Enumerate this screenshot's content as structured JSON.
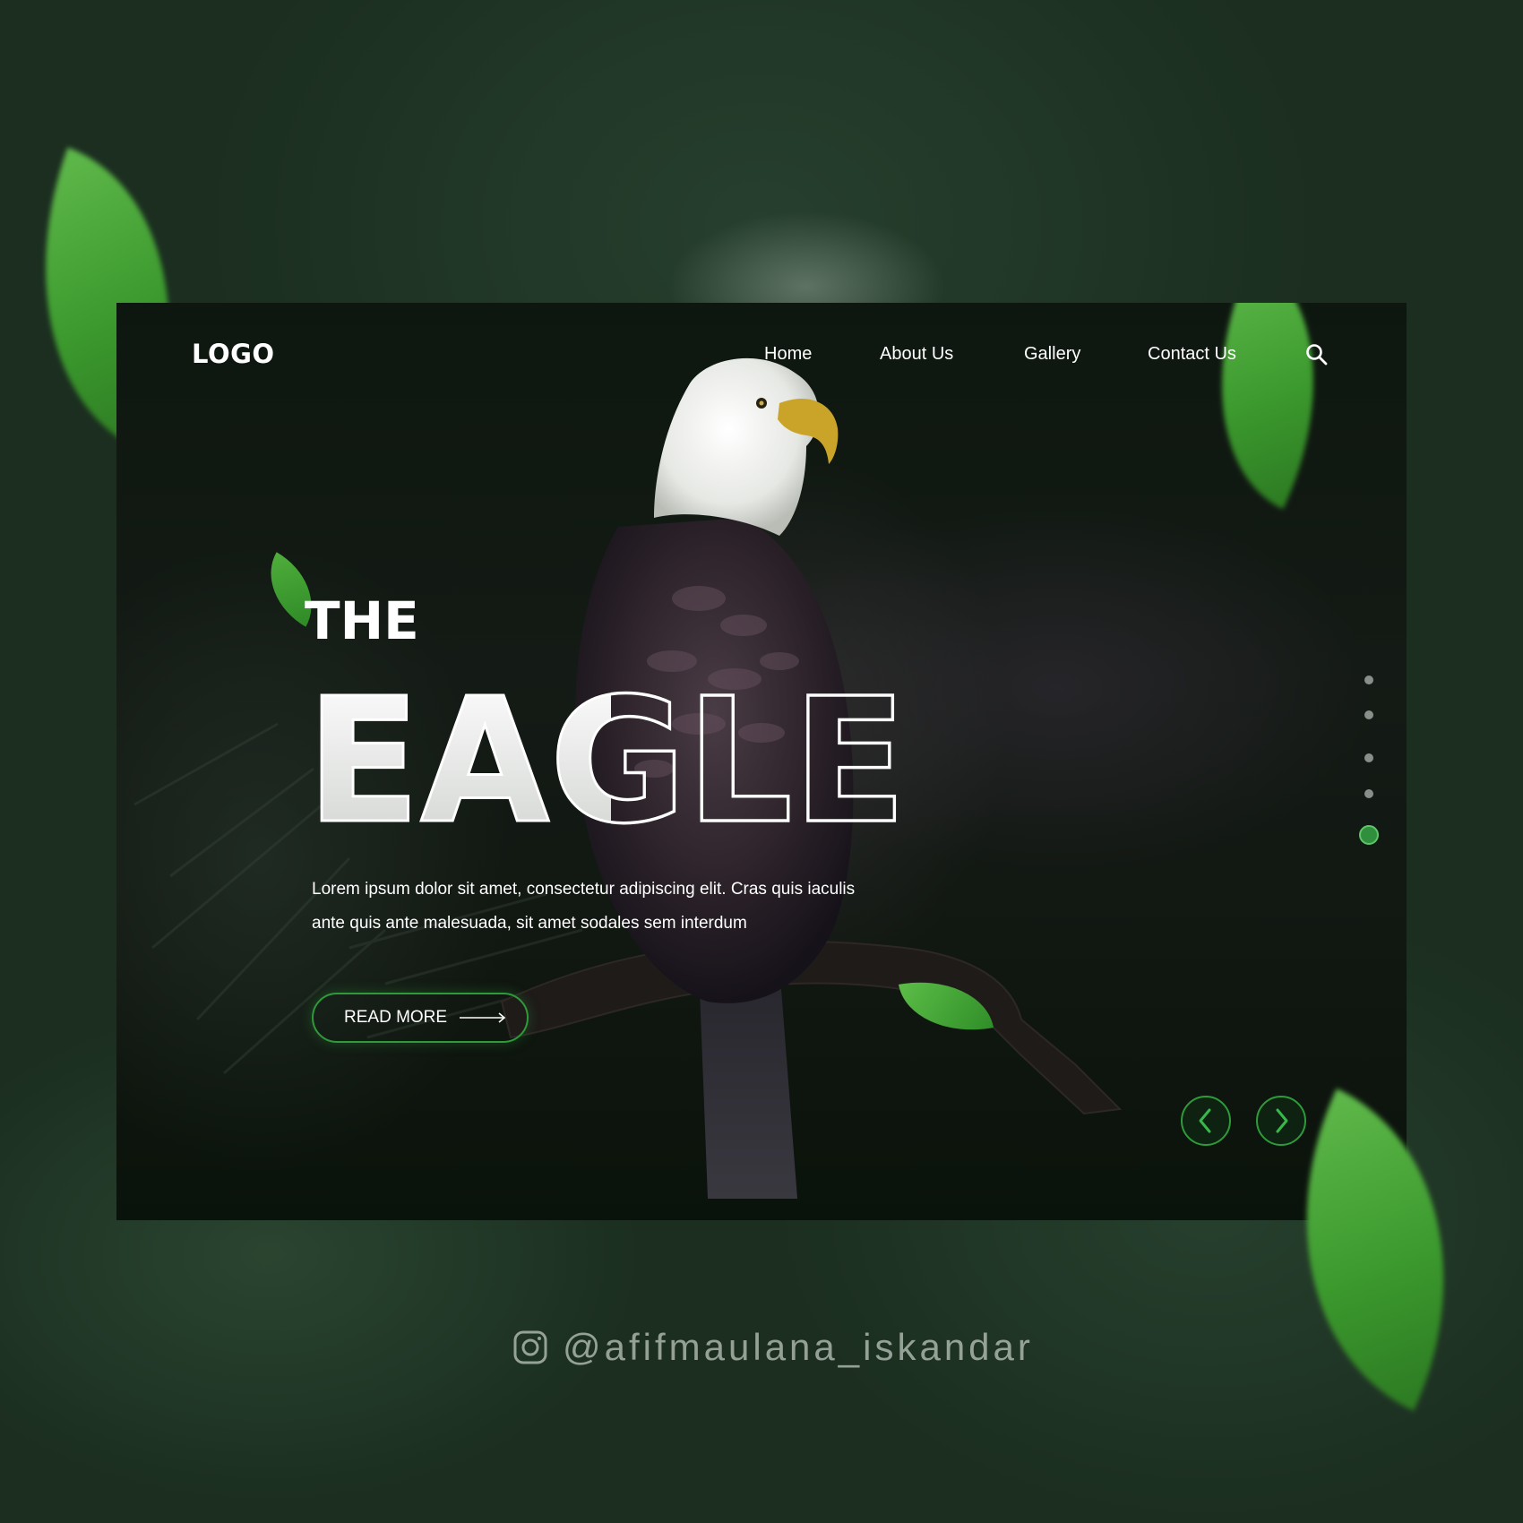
{
  "nav": {
    "logo": "LOGO",
    "links": [
      "Home",
      "About Us",
      "Gallery",
      "Contact Us"
    ],
    "search_icon": "search-icon"
  },
  "hero": {
    "pretitle": "THE",
    "title": "EAGLE",
    "description_line1": "Lorem ipsum dolor sit amet, consectetur adipiscing elit. Cras quis iaculis",
    "description_line2": "ante quis ante malesuada, sit amet sodales sem interdum",
    "cta_label": "READ MORE"
  },
  "slider": {
    "total_slides": 5,
    "active_slide": 5,
    "prev_icon": "chevron-left-icon",
    "next_icon": "chevron-right-icon"
  },
  "credit": {
    "icon": "instagram-icon",
    "handle": "@afifmaulana_iskandar"
  },
  "colors": {
    "accent": "#2e9a3a",
    "leaf": "#4caf3c",
    "background": "#1b2e20",
    "card": "#111711"
  }
}
